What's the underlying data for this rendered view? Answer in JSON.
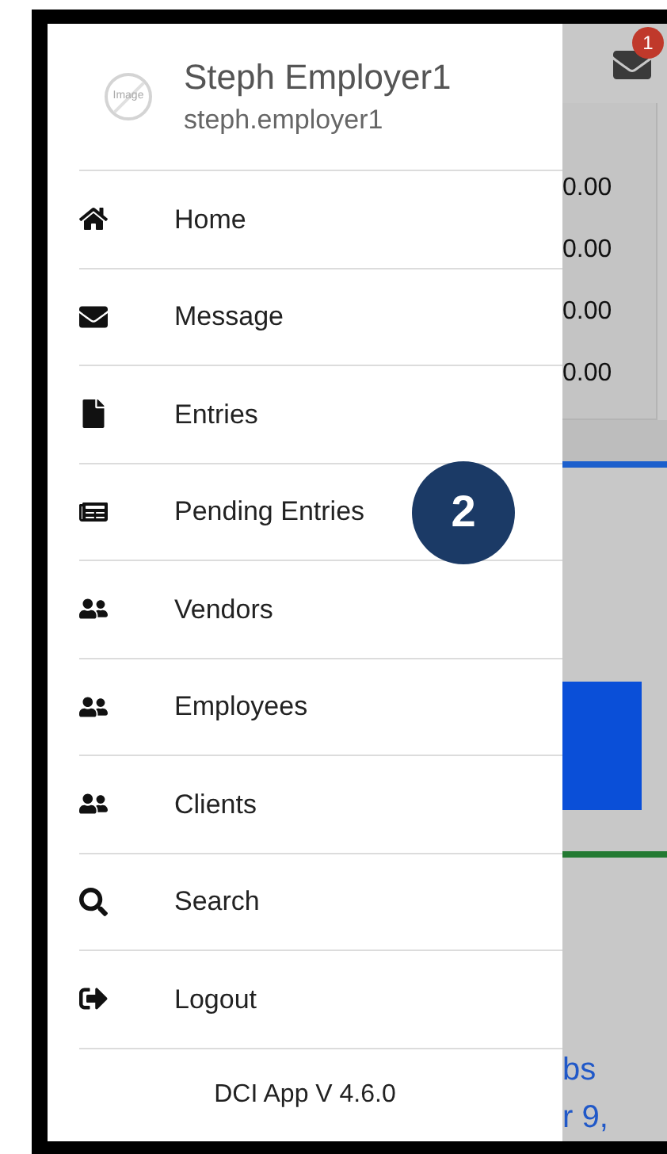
{
  "header": {
    "avatar_text": "Image",
    "name": "Steph Employer1",
    "username": "steph.employer1"
  },
  "menu": [
    {
      "label": "Home",
      "kind": "home"
    },
    {
      "label": "Message",
      "kind": "message"
    },
    {
      "label": "Entries",
      "kind": "entries"
    },
    {
      "label": "Pending Entries",
      "kind": "pending",
      "callout": "2"
    },
    {
      "label": "Vendors",
      "kind": "people"
    },
    {
      "label": "Employees",
      "kind": "people"
    },
    {
      "label": "Clients",
      "kind": "people"
    },
    {
      "label": "Search",
      "kind": "search"
    },
    {
      "label": "Logout",
      "kind": "logout"
    }
  ],
  "footer": "DCI App V 4.6.0",
  "background": {
    "notification_count": "1",
    "amounts": [
      "0.00",
      "0.00",
      "0.00",
      "0.00"
    ],
    "link_lines": [
      "bs",
      "r 9,"
    ]
  }
}
